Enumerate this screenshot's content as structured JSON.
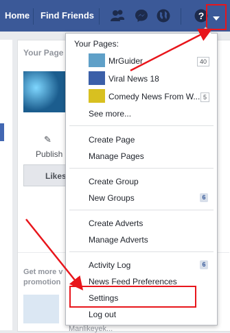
{
  "topbar": {
    "home_label": "Home",
    "find_friends_label": "Find Friends",
    "icons": [
      "friend-requests-icon",
      "messenger-icon",
      "notifications-globe-icon",
      "help-icon",
      "account-menu-caret-icon"
    ]
  },
  "background": {
    "card_title": "Your Page",
    "publish_label": "Publish",
    "like_label": "Likes",
    "promo_text": "Get more v promotion",
    "bottom_text": "Manlikeyek..."
  },
  "menu": {
    "your_pages_label": "Your Pages:",
    "pages": [
      {
        "name": "MrGuider",
        "count": "40"
      },
      {
        "name": "Viral News 18",
        "count": ""
      },
      {
        "name": "Comedy News From W...",
        "count": "5"
      }
    ],
    "see_more": "See more...",
    "create_page": "Create Page",
    "manage_pages": "Manage Pages",
    "create_group": "Create Group",
    "new_groups": "New Groups",
    "new_groups_badge": "6",
    "create_adverts": "Create Adverts",
    "manage_adverts": "Manage Adverts",
    "activity_log": "Activity Log",
    "activity_log_badge": "6",
    "news_feed_prefs": "News Feed Preferences",
    "settings": "Settings",
    "log_out": "Log out"
  },
  "colors": {
    "brand": "#3b5998",
    "annotation_red": "#e8151b",
    "badge_bg": "#d8dfea"
  }
}
